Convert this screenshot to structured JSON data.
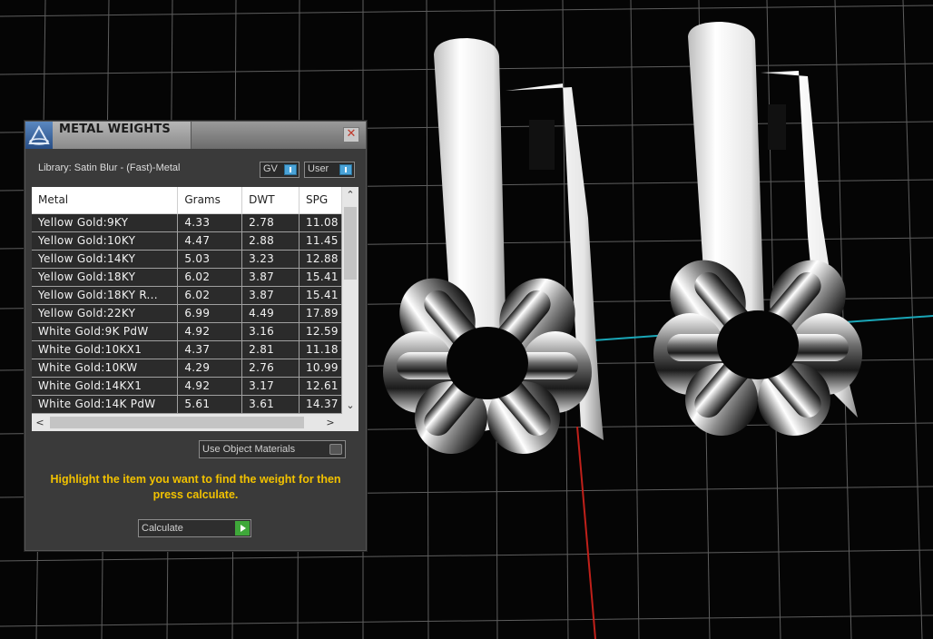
{
  "panel": {
    "title": "METAL WEIGHTS",
    "library_label": "Library: Satin Blur - (Fast)-Metal",
    "toggle_gv": "GV",
    "toggle_user": "User",
    "close_glyph": "✕",
    "use_object_materials": "Use Object Materials",
    "instruction": "Highlight the item you want to find the weight for then press calculate.",
    "calculate_label": "Calculate"
  },
  "table": {
    "headers": [
      "Metal",
      "Grams",
      "DWT",
      "SPG"
    ],
    "rows": [
      [
        "Yellow Gold:9KY",
        "4.33",
        "2.78",
        "11.08"
      ],
      [
        "Yellow Gold:10KY",
        "4.47",
        "2.88",
        "11.45"
      ],
      [
        "Yellow Gold:14KY",
        "5.03",
        "3.23",
        "12.88"
      ],
      [
        "Yellow Gold:18KY",
        "6.02",
        "3.87",
        "15.41"
      ],
      [
        "Yellow Gold:18KY R...",
        "6.02",
        "3.87",
        "15.41"
      ],
      [
        "Yellow Gold:22KY",
        "6.99",
        "4.49",
        "17.89"
      ],
      [
        "White Gold:9K PdW",
        "4.92",
        "3.16",
        "12.59"
      ],
      [
        "White Gold:10KX1",
        "4.37",
        "2.81",
        "11.18"
      ],
      [
        "White Gold:10KW",
        "4.29",
        "2.76",
        "10.99"
      ],
      [
        "White Gold:14KX1",
        "4.92",
        "3.17",
        "12.61"
      ],
      [
        "White Gold:14K PdW",
        "5.61",
        "3.61",
        "14.37"
      ]
    ]
  },
  "colors": {
    "accent_blue": "#4aa3d8",
    "instruction_yellow": "#f2c200",
    "play_green": "#3fa83a",
    "axis_red": "#c0201a",
    "axis_cyan": "#1aa7b8"
  },
  "icons": {
    "logo": "app-logo-icon",
    "close": "close-icon",
    "play": "play-icon",
    "scroll_up": "chevron-up-icon",
    "scroll_down": "chevron-down-icon",
    "scroll_left": "chevron-left-icon",
    "scroll_right": "chevron-right-icon"
  }
}
